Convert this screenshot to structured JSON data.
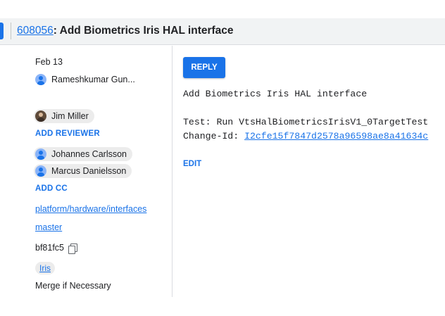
{
  "header": {
    "change_number": "608056",
    "title": ": Add Biometrics Iris HAL interface"
  },
  "sidebar": {
    "date": "Feb 13",
    "owner": "Rameshkumar Gun...",
    "reviewers": [
      "Jim Miller"
    ],
    "add_reviewer": "ADD REVIEWER",
    "cc": [
      "Johannes Carlsson",
      "Marcus Danielsson"
    ],
    "add_cc": "ADD CC",
    "repo": "platform/hardware/interfaces",
    "branch": "master",
    "commit": "bf81fc5",
    "topic": "Iris",
    "submit_strategy": "Merge if Necessary"
  },
  "main": {
    "reply_label": "REPLY",
    "message_subject": "Add Biometrics Iris HAL interface",
    "test_line": "Test: Run VtsHalBiometricsIrisV1_0TargetTest",
    "change_id_label": "Change-Id: ",
    "change_id": "I2cfe15f7847d2578a96598ae8a41634c",
    "edit_label": "EDIT"
  },
  "colors": {
    "accent": "#1a73e8",
    "header_bg": "#f1f3f4",
    "chip_bg": "#ececec"
  },
  "icons": [
    "person-avatar-icon",
    "user-photo-icon",
    "copy-icon"
  ]
}
